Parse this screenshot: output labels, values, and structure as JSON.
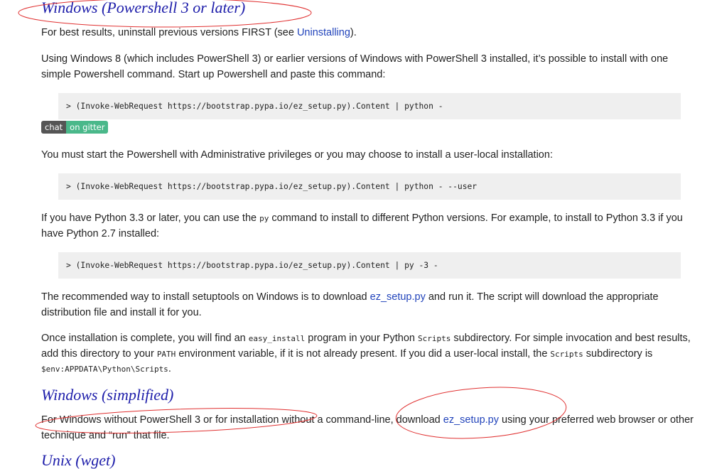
{
  "sections": {
    "powershell": {
      "title": "Windows (Powershell 3 or later)",
      "p1_before": "For best results, uninstall previous versions FIRST (see ",
      "p1_link": "Uninstalling",
      "p1_after": ").",
      "p2": "Using Windows 8 (which includes PowerShell 3) or earlier versions of Windows with PowerShell 3 installed, it’s possible to install with one simple Powershell command. Start up Powershell and paste this command:",
      "code1": "> (Invoke-WebRequest https://bootstrap.pypa.io/ez_setup.py).Content | python -",
      "badge_left": "chat",
      "badge_right": "on gitter",
      "p3": "You must start the Powershell with Administrative privileges or you may choose to install a user-local installation:",
      "code2": "> (Invoke-WebRequest https://bootstrap.pypa.io/ez_setup.py).Content | python - --user",
      "p4_before": "If you have Python 3.3 or later, you can use the ",
      "p4_code": "py",
      "p4_after": " command to install to different Python versions. For example, to install to Python 3.3 if you have Python 2.7 installed:",
      "code3": "> (Invoke-WebRequest https://bootstrap.pypa.io/ez_setup.py).Content | py -3 -",
      "p5_before": "The recommended way to install setuptools on Windows is to download ",
      "p5_link": "ez_setup.py",
      "p5_after": " and run it. The script will download the appropriate distribution file and install it for you.",
      "p6_a": "Once installation is complete, you will find an ",
      "p6_code1": "easy_install",
      "p6_b": " program in your Python ",
      "p6_code2": "Scripts",
      "p6_c": " subdirectory. For simple invocation and best results, add this directory to your ",
      "p6_code3": "PATH",
      "p6_d": " environment variable, if it is not already present. If you did a user-local install, the ",
      "p6_code4": "Scripts",
      "p6_e": " subdirectory is ",
      "p6_code5": "$env:APPDATA\\Python\\Scripts",
      "p6_f": "."
    },
    "simplified": {
      "title": "Windows (simplified)",
      "p1_before": "For Windows without PowerShell 3 or for installation without a command-line, download ",
      "p1_link": "ez_setup.py",
      "p1_after": " using your preferred web browser or other technique and “run” that file."
    },
    "unix": {
      "title": "Unix (wget)"
    }
  },
  "annotations": {
    "ellipse_color": "#e03030"
  }
}
